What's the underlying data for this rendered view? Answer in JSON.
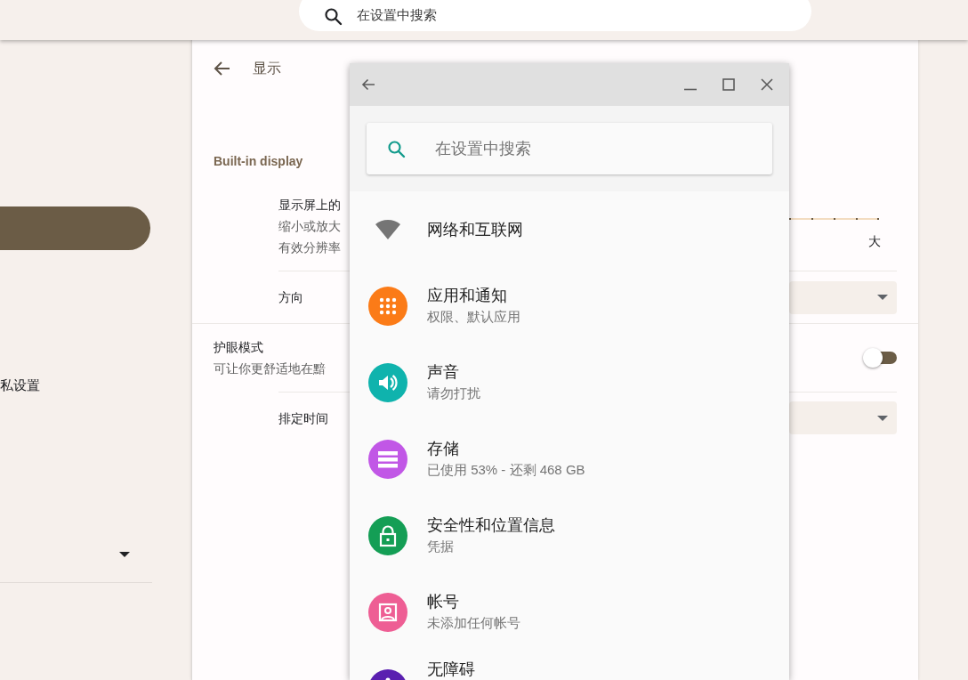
{
  "top_search": {
    "placeholder": "在设置中搜索"
  },
  "sidebar": {
    "items": [
      {
        "kind": "highlight",
        "selected": true
      },
      {
        "kind": "label",
        "label": "私设置",
        "selected": false
      },
      {
        "kind": "dropdown",
        "expanded": false
      }
    ]
  },
  "display_page": {
    "title": "显示",
    "section": "Built-in display",
    "rows": [
      {
        "kind": "slider",
        "title": "显示屏上的",
        "lines": [
          "缩小或放大",
          "有效分辨率"
        ],
        "end_label": "大"
      },
      {
        "kind": "dropdown",
        "title": "方向"
      },
      {
        "kind": "toggle",
        "title": "护眼模式",
        "lines": [
          "可让你更舒适地在黯"
        ],
        "on": false
      },
      {
        "kind": "dropdown",
        "title": "排定时间"
      }
    ]
  },
  "settings_window": {
    "search": {
      "placeholder": "在设置中搜索"
    },
    "items": [
      {
        "title": "网络和互联网"
      },
      {
        "title": "应用和通知",
        "subtitle": "权限、默认应用",
        "color": "#fb7b17"
      },
      {
        "title": "声音",
        "subtitle": "请勿打扰",
        "color": "#0fb3ad"
      },
      {
        "title": "存储",
        "subtitle": "已使用 53% - 还剩 468 GB",
        "color": "#c157e6"
      },
      {
        "title": "安全性和位置信息",
        "subtitle": "凭据",
        "color": "#149e55"
      },
      {
        "title": "帐号",
        "subtitle": "未添加任何帐号",
        "color": "#ee5e94"
      },
      {
        "title": "无障碍",
        "color": "#5a1fb0"
      }
    ]
  }
}
